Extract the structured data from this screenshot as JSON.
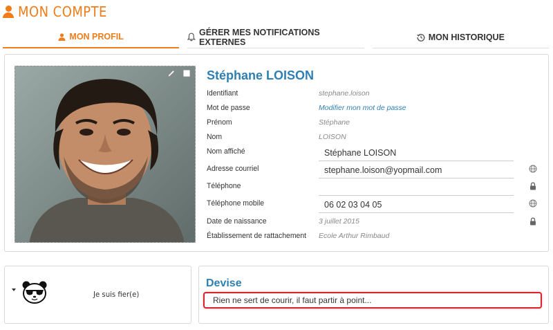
{
  "header": {
    "title": "MON COMPTE",
    "icon": "user-icon",
    "accent": "#f07c1a"
  },
  "tabs": [
    {
      "label": "MON PROFIL",
      "icon": "user-icon",
      "active": true
    },
    {
      "label": "GÉRER MES NOTIFICATIONS EXTERNES",
      "icon": "bell-icon",
      "active": false
    },
    {
      "label": "MON HISTORIQUE",
      "icon": "history-icon",
      "active": false
    }
  ],
  "profile": {
    "name": "Stéphane LOISON",
    "photo_tools": [
      "pencil-icon",
      "square-icon"
    ],
    "fields": {
      "identifiant": {
        "label": "Identifiant",
        "value": "stephane.loison"
      },
      "password": {
        "label": "Mot de passe",
        "value": "Modifier mon mot de passe"
      },
      "prenom": {
        "label": "Prénom",
        "value": "Stéphane"
      },
      "nom": {
        "label": "Nom",
        "value": "LOISON"
      },
      "nom_affiche": {
        "label": "Nom affiché",
        "value": "Stéphane LOISON"
      },
      "email": {
        "label": "Adresse courriel",
        "value": "stephane.loison@yopmail.com",
        "icon": "globe-icon"
      },
      "telephone": {
        "label": "Téléphone",
        "value": "",
        "icon": "lock-icon"
      },
      "mobile": {
        "label": "Téléphone mobile",
        "value": "06 02 03 04 05",
        "icon": "globe-icon"
      },
      "naissance": {
        "label": "Date de naissance",
        "value": "3 juillet 2015",
        "icon": "lock-icon"
      },
      "etablissement": {
        "label": "Établissement de rattachement",
        "value": "Ecole Arthur Rimbaud"
      }
    }
  },
  "mood": {
    "text": "Je suis fier(e)",
    "icon": "panda-icon"
  },
  "devise": {
    "title": "Devise",
    "value": "Rien ne sert de courir, il faut partir à point..."
  },
  "colors": {
    "link": "#2f7fb3",
    "focus_border": "#d9222a"
  }
}
